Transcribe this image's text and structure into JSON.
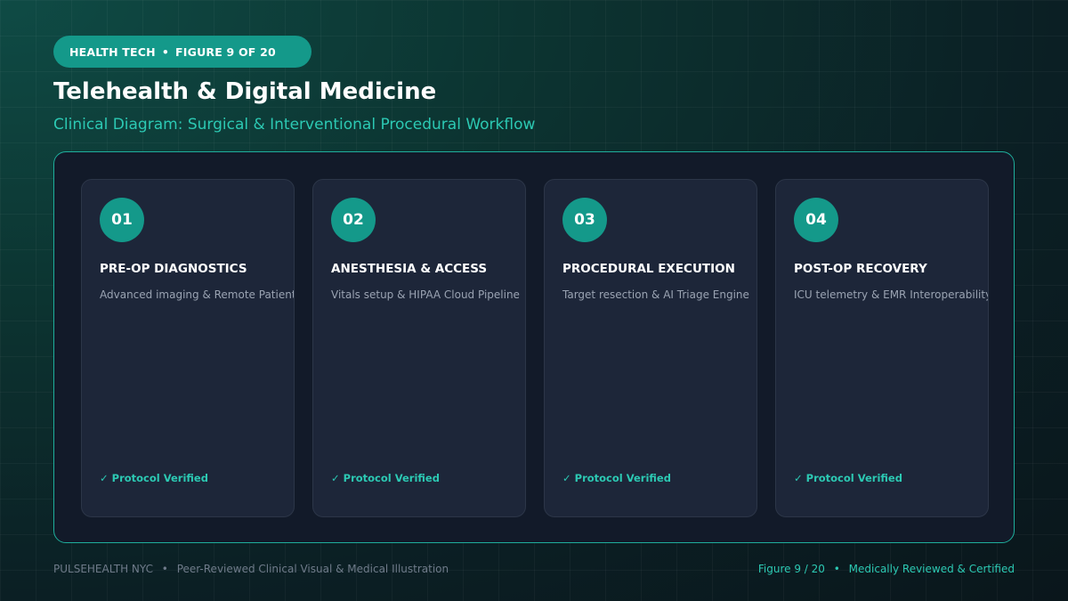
{
  "header": {
    "category": "HEALTH TECH",
    "separator": "•",
    "figure_label": "FIGURE 9 OF 20",
    "title": "Telehealth & Digital Medicine",
    "subtitle": "Clinical Diagram: Surgical & Interventional Procedural Workflow"
  },
  "steps": [
    {
      "number": "01",
      "title": "PRE-OP DIAGNOSTICS",
      "description": "Advanced imaging & Remote Patient Telemetry",
      "status": "✓ Protocol Verified"
    },
    {
      "number": "02",
      "title": "ANESTHESIA & ACCESS",
      "description": "Vitals setup & HIPAA Cloud Pipeline",
      "status": "✓ Protocol Verified"
    },
    {
      "number": "03",
      "title": "PROCEDURAL EXECUTION",
      "description": "Target resection & AI Triage Engine",
      "status": "✓ Protocol Verified"
    },
    {
      "number": "04",
      "title": "POST-OP RECOVERY",
      "description": "ICU telemetry & EMR Interoperability",
      "status": "✓ Protocol Verified"
    }
  ],
  "footer": {
    "brand": "PULSEHEALTH NYC",
    "separator": "•",
    "tagline": "Peer-Reviewed Clinical Visual & Medical Illustration",
    "figure": "Figure 9 / 20",
    "certification": "Medically Reviewed & Certified"
  },
  "colors": {
    "accent": "#14998a",
    "accent_text": "#2cc9b3",
    "panel_bg": "#121a29",
    "card_bg": "#1d2639"
  }
}
